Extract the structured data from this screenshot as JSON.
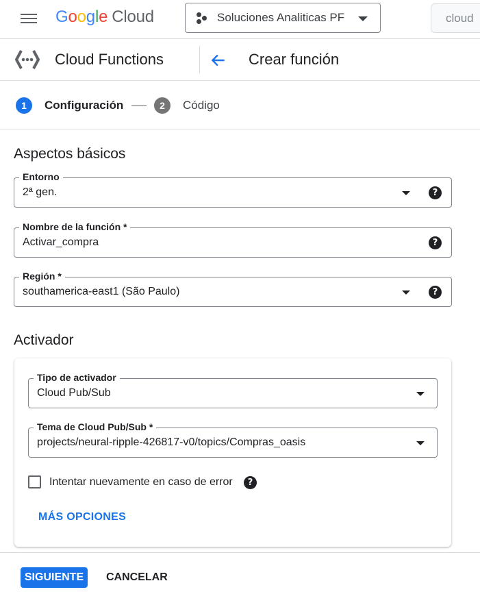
{
  "header": {
    "logo_google": [
      "G",
      "o",
      "o",
      "g",
      "l",
      "e"
    ],
    "logo_cloud": "Cloud",
    "project_name": "Soluciones Analiticas PF",
    "search_text": "cloud"
  },
  "service": {
    "name": "Cloud Functions",
    "page_title": "Crear función",
    "icon": "cloud-functions-icon"
  },
  "stepper": {
    "steps": [
      {
        "number": "1",
        "label": "Configuración",
        "active": true
      },
      {
        "number": "2",
        "label": "Código",
        "active": false
      }
    ]
  },
  "basics": {
    "title": "Aspectos básicos",
    "environment": {
      "label": "Entorno",
      "value": "2ª gen."
    },
    "function_name": {
      "label": "Nombre de la función *",
      "value": "Activar_compra"
    },
    "region": {
      "label": "Región *",
      "value": "southamerica-east1 (São Paulo)"
    }
  },
  "trigger": {
    "title": "Activador",
    "trigger_type": {
      "label": "Tipo de activador",
      "value": "Cloud Pub/Sub"
    },
    "topic": {
      "label": "Tema de Cloud Pub/Sub *",
      "value": "projects/neural-ripple-426817-v0/topics/Compras_oasis"
    },
    "retry_label": "Intentar nuevamente en caso de error",
    "retry_checked": false,
    "more_options": "MÁS OPCIONES"
  },
  "actions": {
    "next": "SIGUIENTE",
    "cancel": "CANCELAR"
  },
  "colors": {
    "primary": "#1a73e8",
    "step_inactive": "#757575",
    "border": "#80868b"
  }
}
